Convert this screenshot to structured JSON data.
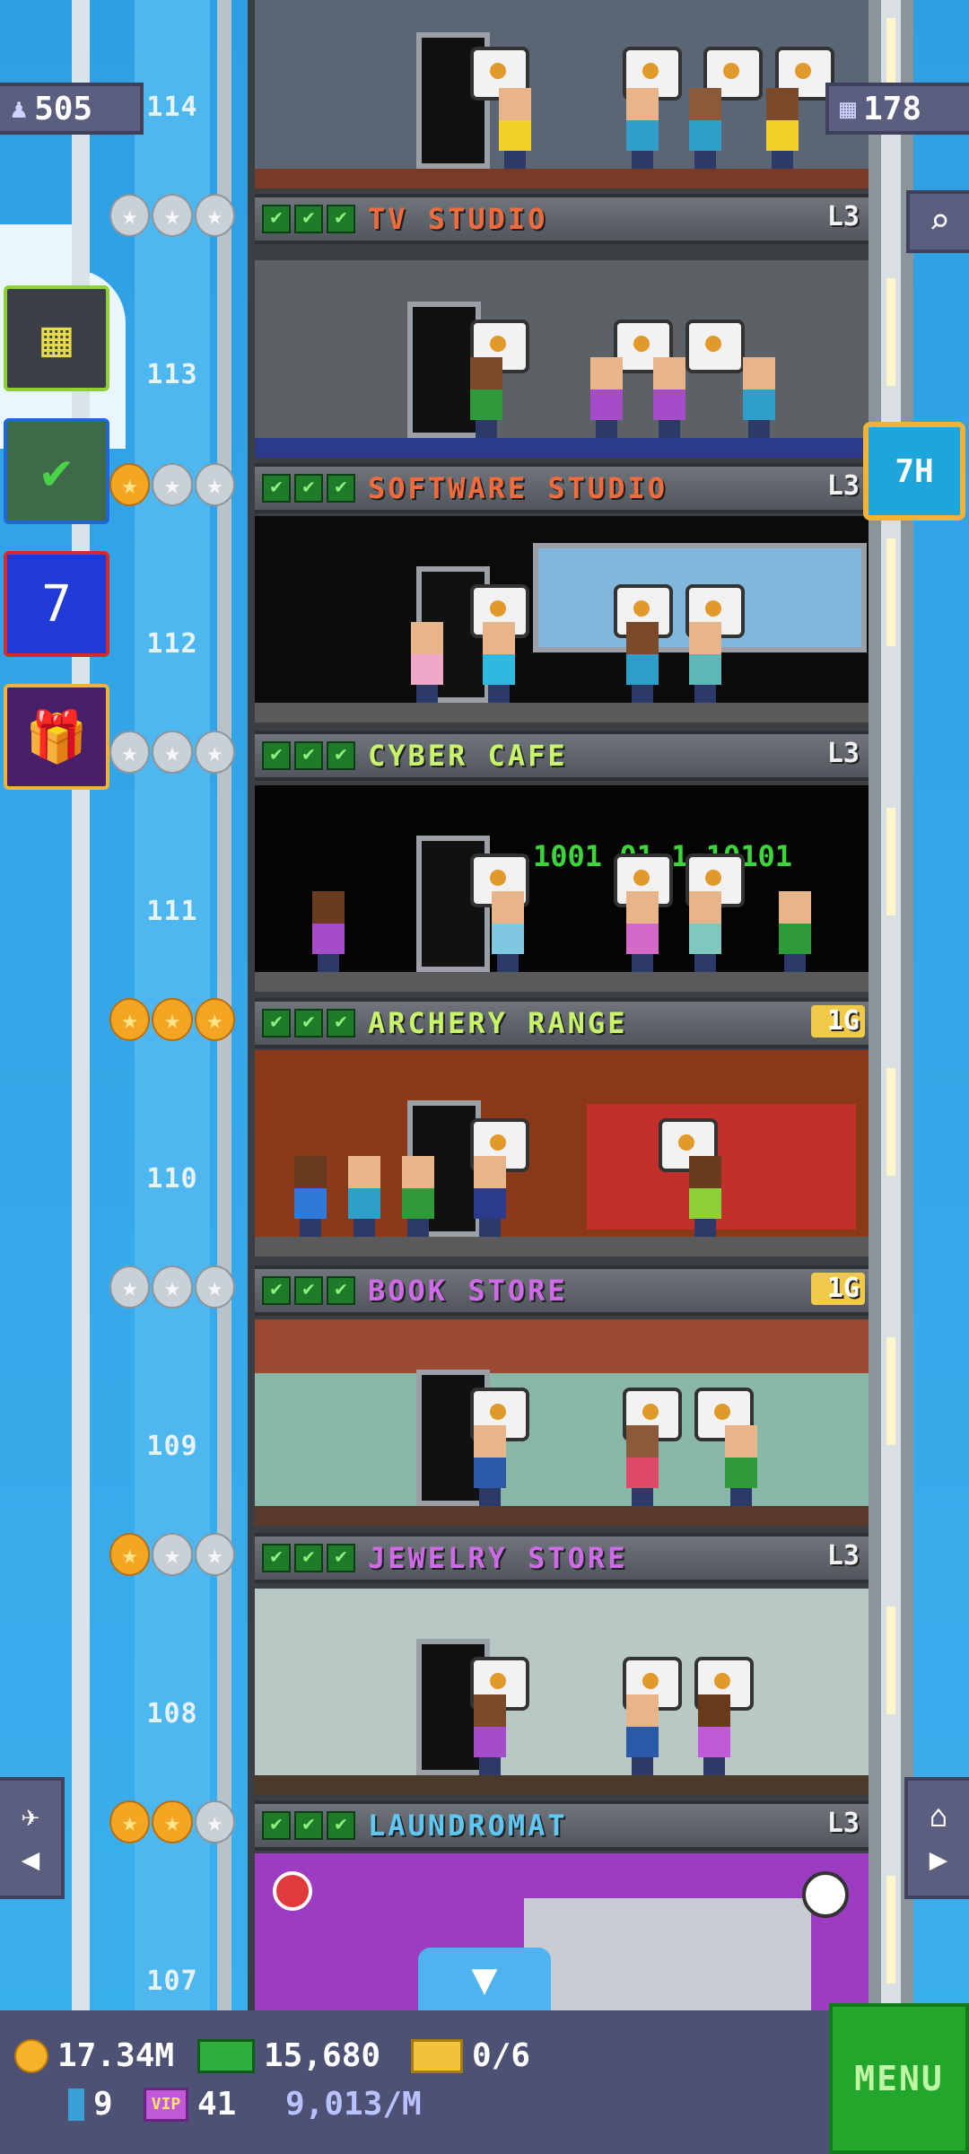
{
  "hud": {
    "population": "505",
    "stories": "178",
    "elevator_timer": "7H"
  },
  "floors": [
    {
      "number": "114",
      "name": "TV STUDIO",
      "level": "L3",
      "label_color": "#f26b3c",
      "stars": [
        "silver",
        "silver",
        "silver"
      ]
    },
    {
      "number": "113",
      "name": "SOFTWARE STUDIO",
      "level": "L3",
      "label_color": "#f26b3c",
      "stars": [
        "gold",
        "silver",
        "silver"
      ]
    },
    {
      "number": "112",
      "name": "CYBER CAFE",
      "level": "L3",
      "label_color": "#c8f36a",
      "stars": [
        "silver",
        "silver",
        "silver"
      ]
    },
    {
      "number": "111",
      "name": "ARCHERY RANGE",
      "level": "1G",
      "label_color": "#c8f36a",
      "stars": [
        "gold",
        "gold",
        "gold"
      ]
    },
    {
      "number": "110",
      "name": "BOOK STORE",
      "level": "1G",
      "label_color": "#cf6be6",
      "stars": [
        "silver",
        "silver",
        "silver"
      ]
    },
    {
      "number": "109",
      "name": "JEWELRY STORE",
      "level": "L3",
      "label_color": "#cf6be6",
      "stars": [
        "gold",
        "silver",
        "silver"
      ]
    },
    {
      "number": "108",
      "name": "LAUNDROMAT",
      "level": "L3",
      "label_color": "#5fc7f2",
      "stars": [
        "gold",
        "gold",
        "silver"
      ]
    },
    {
      "number": "107",
      "name": "",
      "level": "",
      "label_color": "",
      "stars": []
    }
  ],
  "bottom": {
    "coins": "17.34M",
    "bux": "15,680",
    "tickets": "0/6",
    "bitizens": "9",
    "vip": "41",
    "income": "9,013/M",
    "menu_label": "MENU"
  },
  "colors": {
    "sky": "#3aa9e6",
    "menu_green": "#22a72c",
    "panel": "#5b5e7f"
  }
}
